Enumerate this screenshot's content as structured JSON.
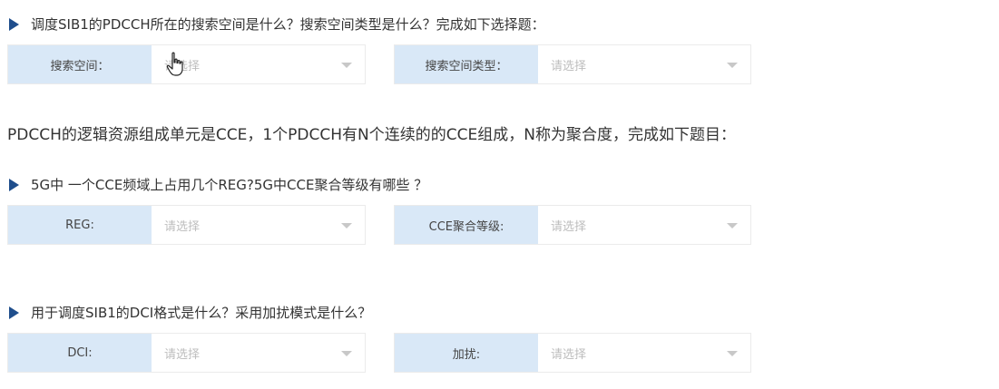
{
  "questions": [
    {
      "text": "调度SIB1的PDCCH所在的搜索空间是什么？搜索空间类型是什么？完成如下选择题：",
      "fields": [
        {
          "label": "搜索空间：",
          "placeholder": "请选择"
        },
        {
          "label": "搜索空间类型：",
          "placeholder": "请选择"
        }
      ]
    },
    {
      "text": "5G中 一个CCE频域上占用几个REG?5G中CCE聚合等级有哪些 ？",
      "fields": [
        {
          "label": "REG:",
          "placeholder": "请选择"
        },
        {
          "label": "CCE聚合等级:",
          "placeholder": "请选择"
        }
      ]
    },
    {
      "text": "用于调度SIB1的DCI格式是什么？采用加扰模式是什么？",
      "fields": [
        {
          "label": "DCI:",
          "placeholder": "请选择"
        },
        {
          "label": "加扰:",
          "placeholder": "请选择"
        }
      ]
    }
  ],
  "info_text": "PDCCH的逻辑资源组成单元是CCE，1个PDCCH有N个连续的的CCE组成，N称为聚合度，完成如下题目：",
  "colors": {
    "label_bg": "#d9e8f7",
    "triangle": "#1f4e8c",
    "placeholder": "#bdbdbd"
  },
  "icons": {
    "bullet": "triangle-right-icon",
    "dropdown": "chevron-down-icon",
    "cursor": "hand-cursor-icon"
  }
}
